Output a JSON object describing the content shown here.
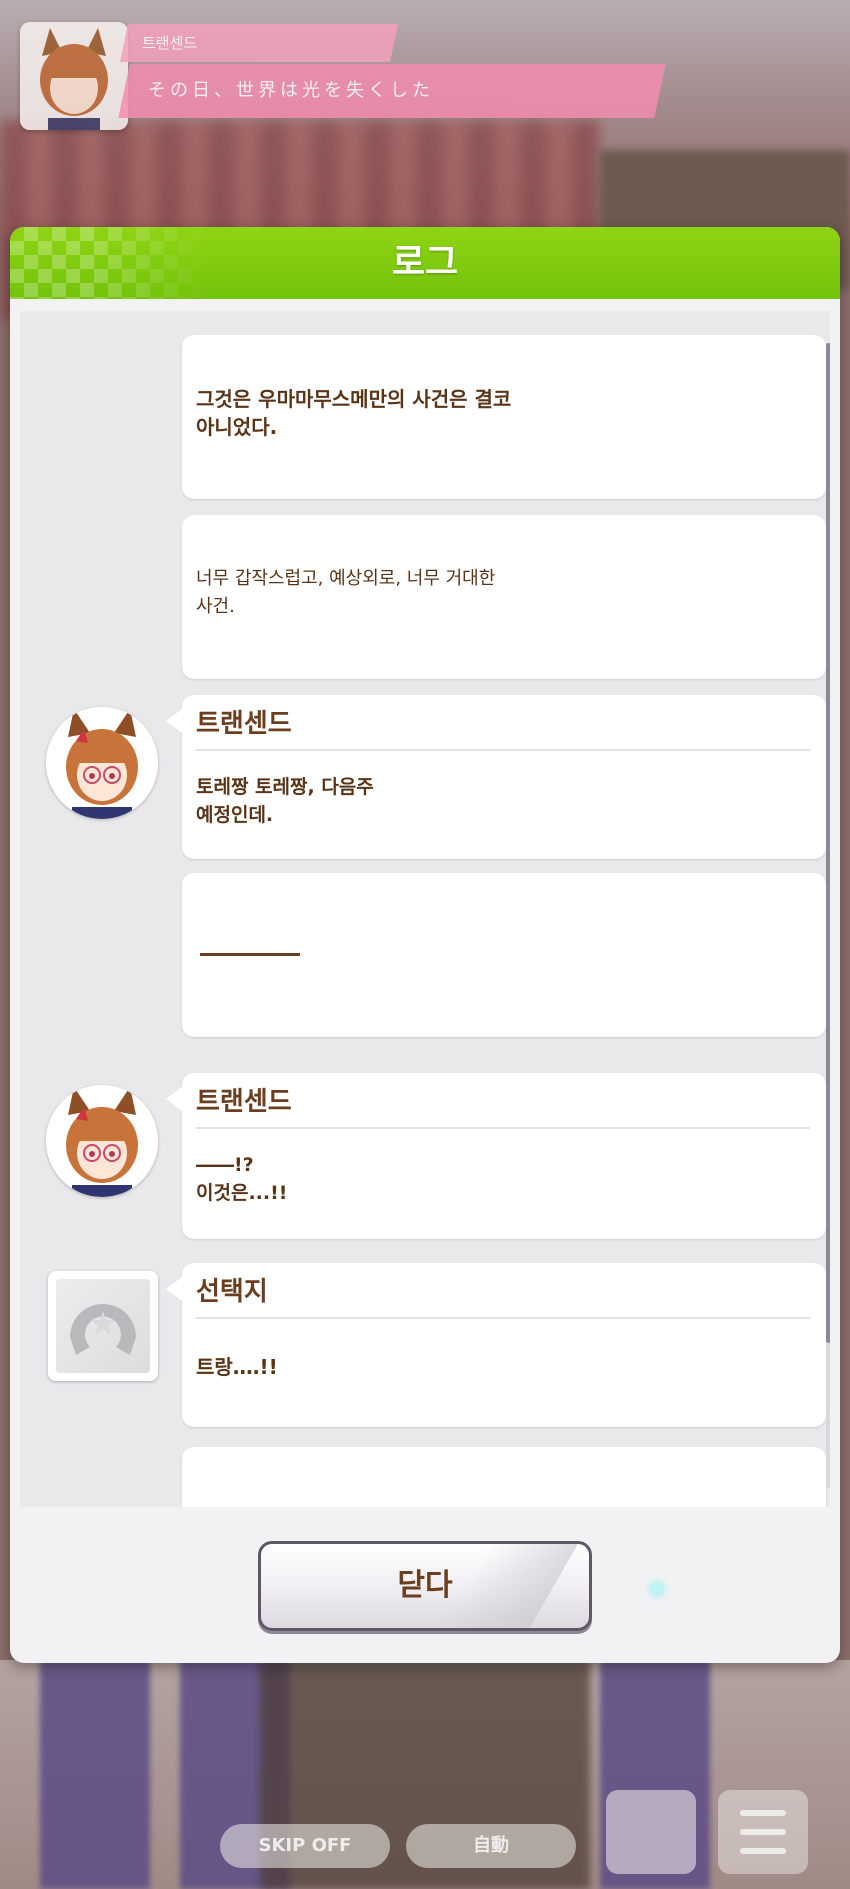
{
  "top_dialog": {
    "speaker": "트랜센드",
    "text": "その日、世界は光を失くした"
  },
  "log_panel": {
    "title": "로그",
    "entries": [
      {
        "type": "narration",
        "text": "그것은 우마마무스메만의 사건은 결코\n아니었다."
      },
      {
        "type": "narration",
        "text": "너무 갑작스럽고, 예상외로, 너무 거대한\n사건."
      },
      {
        "type": "dialogue",
        "speaker": "트랜센드",
        "text": "토레짱 토레짱, 다음주\n예정인데."
      },
      {
        "type": "narration",
        "text": "――――"
      },
      {
        "type": "dialogue",
        "speaker": "트랜센드",
        "text": "――!?\n이것은...!!"
      },
      {
        "type": "choice",
        "speaker": "선택지",
        "text": "트랑‥‥!!"
      }
    ],
    "close_label": "닫다"
  },
  "bottom_controls": {
    "skip_label": "SKIP OFF",
    "auto_label": "自動",
    "menu_icon": "hamburger-menu-icon",
    "auto_icon": "auto-play-icon"
  },
  "colors": {
    "header_green": "#7cc80e",
    "text_brown": "#6b3e1f",
    "button_border": "#5d5766"
  }
}
